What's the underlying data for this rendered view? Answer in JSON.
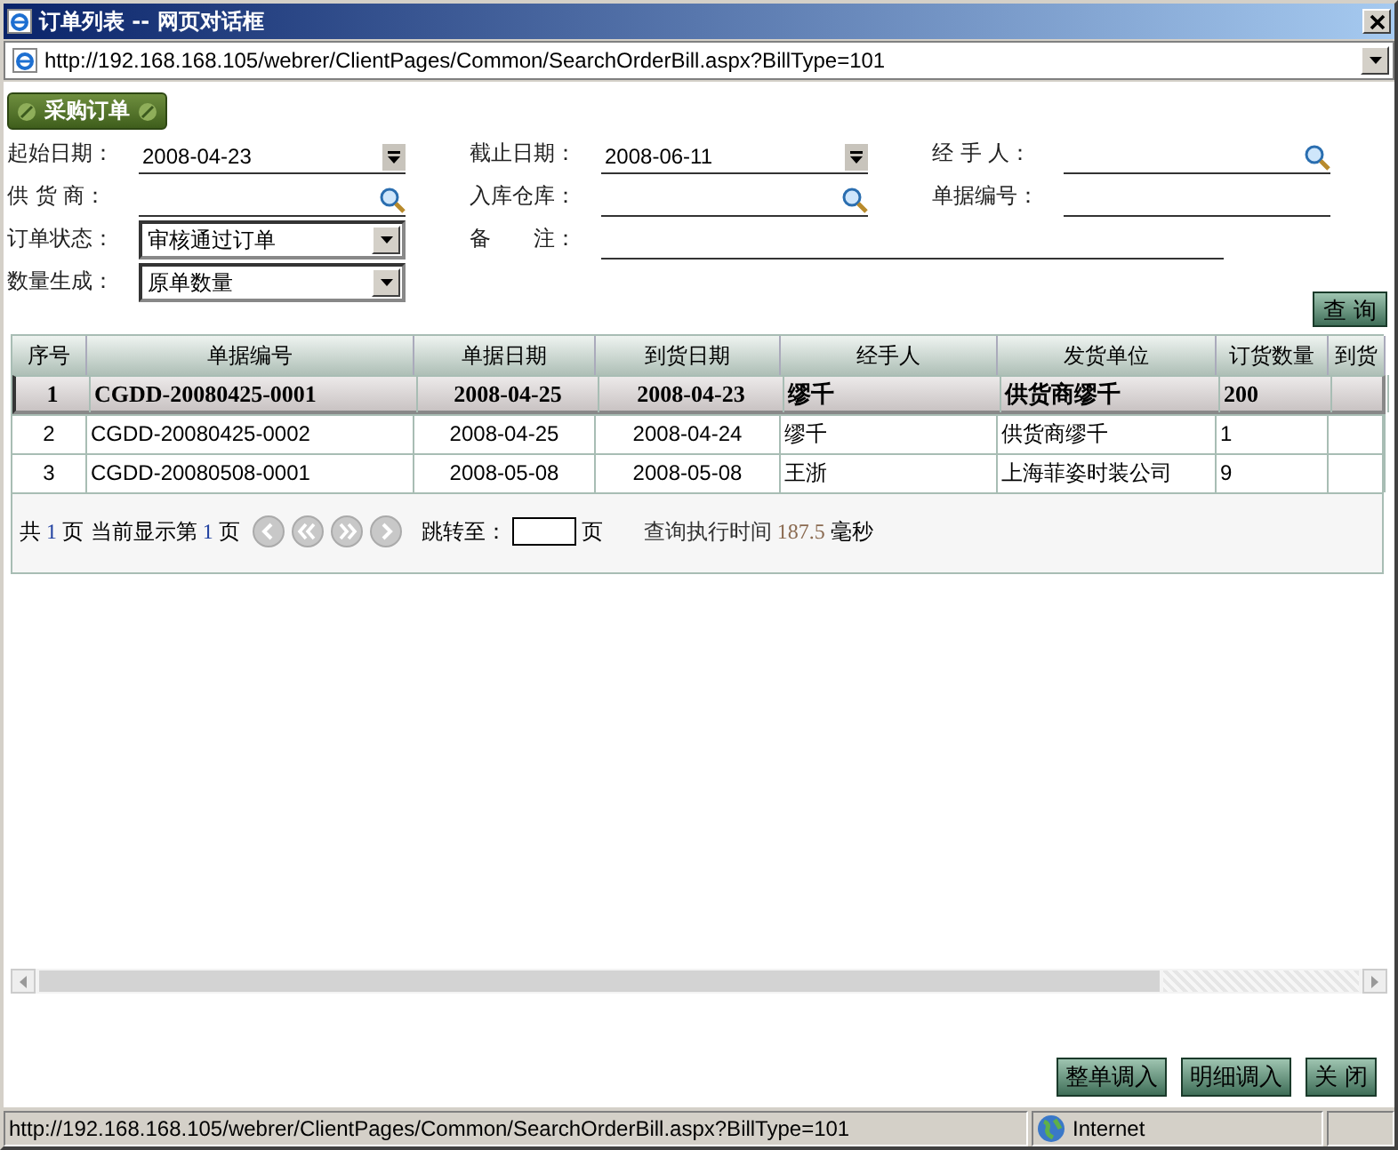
{
  "window": {
    "title": "订单列表 -- 网页对话框",
    "address": "http://192.168.168.105/webrer/ClientPages/Common/SearchOrderBill.aspx?BillType=101"
  },
  "section_title": "采购订单",
  "form": [
    {
      "label": "起始日期：",
      "kind": "date",
      "value": "2008-04-23"
    },
    {
      "label": "截止日期：",
      "kind": "date",
      "value": "2008-06-11"
    },
    {
      "label": "经 手 人：",
      "kind": "lookup"
    },
    {
      "label": "供 货 商：",
      "kind": "lookup"
    },
    {
      "label": "入库仓库：",
      "kind": "lookup"
    },
    {
      "label": "单据编号：",
      "kind": "text"
    },
    {
      "label": "订单状态：",
      "kind": "select",
      "value": "审核通过订单"
    },
    {
      "label": "备　　注：",
      "kind": "wide"
    },
    {
      "label": "数量生成：",
      "kind": "select",
      "value": "原单数量"
    }
  ],
  "query_button": "查 询",
  "table": {
    "columns": [
      "序号",
      "单据编号",
      "单据日期",
      "到货日期",
      "经手人",
      "发货单位",
      "订货数量",
      "到货"
    ],
    "rows": [
      {
        "selected": true,
        "cells": [
          "1",
          "CGDD-20080425-0001",
          "2008-04-25",
          "2008-04-23",
          "缪千",
          "供货商缪千",
          "200",
          ""
        ]
      },
      {
        "selected": false,
        "cells": [
          "2",
          "CGDD-20080425-0002",
          "2008-04-25",
          "2008-04-24",
          "缪千",
          "供货商缪千",
          "1",
          ""
        ]
      },
      {
        "selected": false,
        "cells": [
          "3",
          "CGDD-20080508-0001",
          "2008-05-08",
          "2008-05-08",
          "王浙",
          "上海菲姿时装公司",
          "9",
          ""
        ]
      }
    ]
  },
  "pager": {
    "total_prefix": "共",
    "total_pages": "1",
    "total_suffix": "页 当前显示第",
    "current_page": "1",
    "current_suffix": "页",
    "jump_label": "跳转至：",
    "jump_suffix": "页",
    "time_label": "查询执行时间",
    "time_value": "187.5",
    "time_unit": "毫秒"
  },
  "buttons": [
    "整单调入",
    "明细调入",
    "关 闭"
  ],
  "status_bar": {
    "url": "http://192.168.168.105/webrer/ClientPages/Common/SearchOrderBill.aspx?BillType=101",
    "zone": "Internet"
  }
}
